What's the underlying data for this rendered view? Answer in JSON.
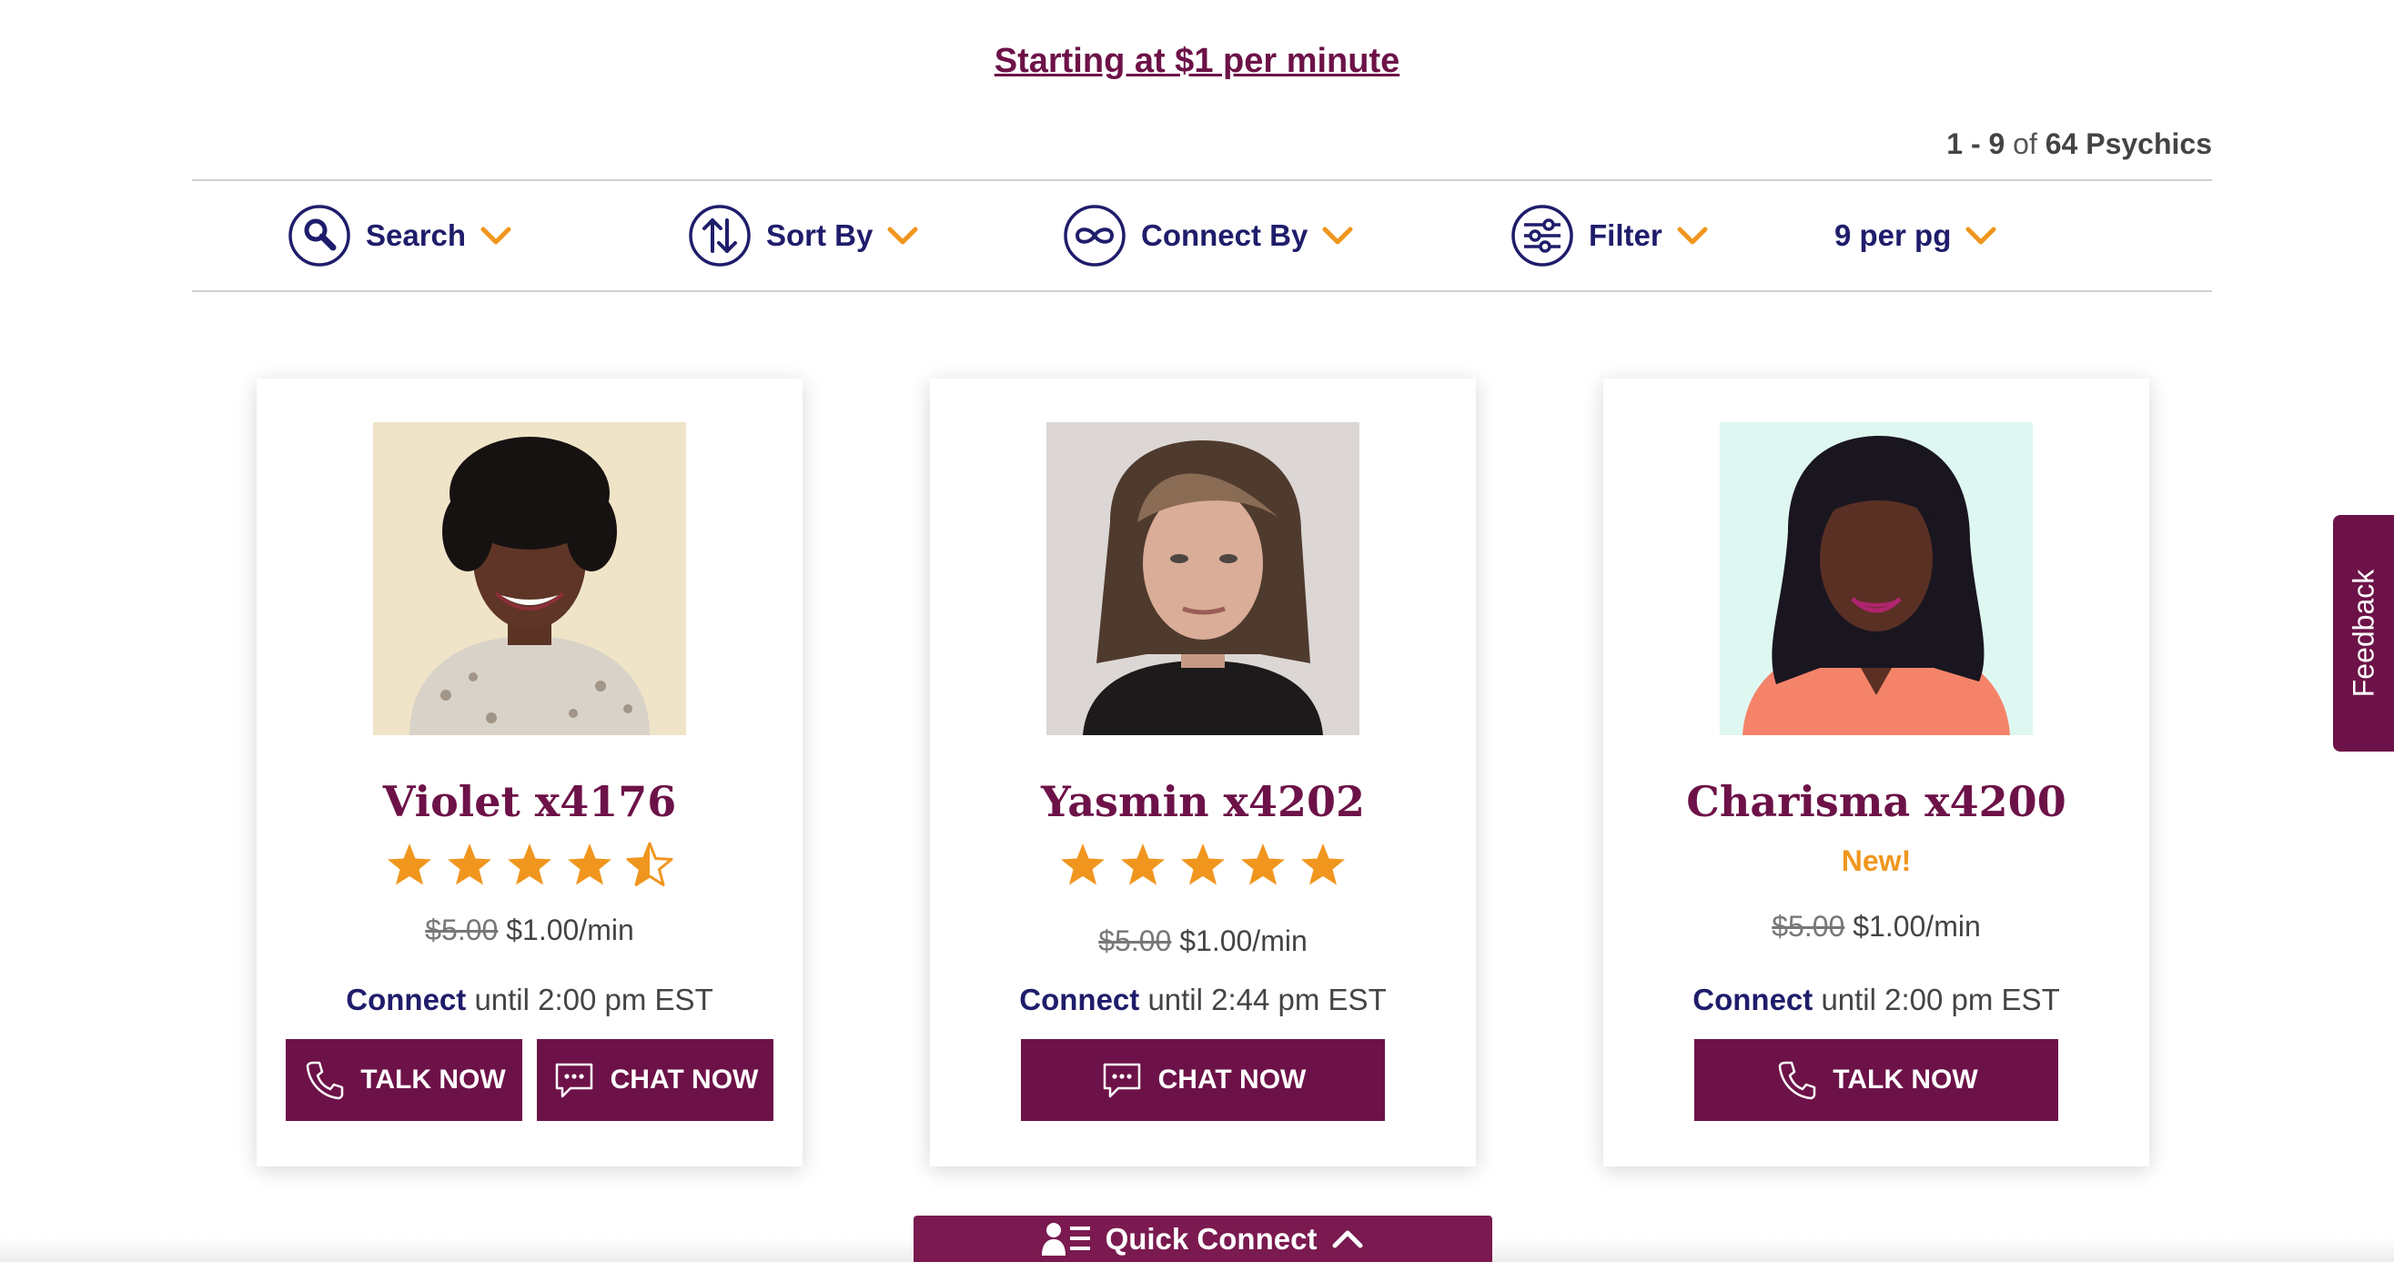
{
  "promo": {
    "text": "Starting at $1 per minute"
  },
  "results": {
    "range": "1 - 9",
    "of": "of",
    "total": "64 Psychics"
  },
  "toolbar": {
    "search": "Search",
    "sort": "Sort By",
    "connect": "Connect By",
    "filter": "Filter",
    "per_page": "9 per pg"
  },
  "cards": [
    {
      "name": "Violet x4176",
      "rating": 4.5,
      "old_price": "$5.00",
      "price": "$1.00/min",
      "connect_label": "Connect",
      "connect_until": "until 2:00 pm EST",
      "talk_label": "TALK NOW",
      "chat_label": "CHAT NOW"
    },
    {
      "name": "Yasmin x4202",
      "rating": 5,
      "old_price": "$5.00",
      "price": "$1.00/min",
      "connect_label": "Connect",
      "connect_until": "until 2:44 pm EST",
      "chat_label": "CHAT NOW"
    },
    {
      "name": "Charisma x4200",
      "badge": "New!",
      "old_price": "$5.00",
      "price": "$1.00/min",
      "connect_label": "Connect",
      "connect_until": "until 2:00 pm EST",
      "talk_label": "TALK NOW"
    }
  ],
  "feedback": {
    "label": "Feedback"
  },
  "quick_connect": {
    "label": "Quick Connect"
  },
  "colors": {
    "brand": "#6d1248",
    "accent": "#f0961e",
    "navy": "#1f1d6b"
  }
}
